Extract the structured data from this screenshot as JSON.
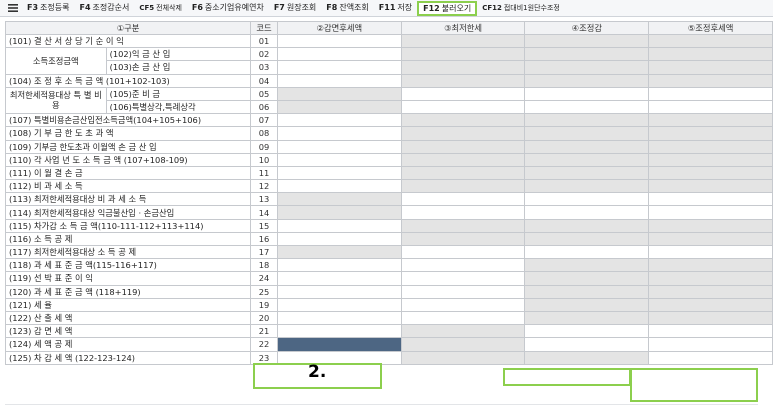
{
  "toolbar": {
    "menu_icon": "hamburger-menu-icon",
    "buttons": [
      {
        "key": "F3",
        "label": "조정등록"
      },
      {
        "key": "F4",
        "label": "조정감순서"
      },
      {
        "key": "CF5",
        "label": "전체삭제"
      },
      {
        "key": "F6",
        "label": "중소기업유예연차"
      },
      {
        "key": "F7",
        "label": "원장조회"
      },
      {
        "key": "F8",
        "label": "잔액조회"
      },
      {
        "key": "F11",
        "label": "저장"
      },
      {
        "key": "F12",
        "label": "불러오기"
      },
      {
        "key": "CF12",
        "label": "접대비1원단수조정"
      }
    ]
  },
  "table": {
    "headers": [
      "①구분",
      "코드",
      "②감면후세액",
      "③최저한세",
      "④조정감",
      "⑤조정후세액"
    ],
    "rows": [
      {
        "label": "(101) 결  산  서  상  당  기  순  이  익",
        "code": "01"
      },
      {
        "label": "소득조정금액",
        "sub": "(102)익  금  산  입",
        "code": "02"
      },
      {
        "sub": "(103)손  금  산  입",
        "code": "03"
      },
      {
        "label": "(104) 조  정  후  소  득  금  액 (101+102-103)",
        "code": "04"
      },
      {
        "label": "최저한세적용대상 특 별 비 용",
        "sub": "(105)준       비       금",
        "code": "05"
      },
      {
        "sub": "(106)특별상각,특례상각",
        "code": "06"
      },
      {
        "label": "(107) 특별비용손금산입전소득금액(104+105+106)",
        "code": "07"
      },
      {
        "label": "(108) 기   부   금     한   도   초   과   액",
        "code": "08"
      },
      {
        "label": "(109) 기부금 한도초과 이월액   손  금  산  입",
        "code": "09"
      },
      {
        "label": "(110) 각  사업 년 도 소 득 금 액 (107+108-109)",
        "code": "10"
      },
      {
        "label": "(111) 이        월        결        손        금",
        "code": "11"
      },
      {
        "label": "(112) 비        과        세        소        득",
        "code": "12"
      },
      {
        "label": "(113) 최저한세적용대상   비  과  세  소  득",
        "code": "13"
      },
      {
        "label": "(114) 최저한세적용대상   익금불산입 · 손금산입",
        "code": "14"
      },
      {
        "label": "(115) 차가감 소 득 금 액(110-111-112+113+114)",
        "code": "15"
      },
      {
        "label": "(116) 소        득        공        제",
        "code": "16"
      },
      {
        "label": "(117) 최저한세적용대상   소    득    공    제",
        "code": "17"
      },
      {
        "label": "(118) 과  세  표  준  금  액(115-116+117)",
        "code": "18"
      },
      {
        "label": "(119) 선     박     표     준     이     익",
        "code": "24"
      },
      {
        "label": "(120) 과   세   표  준  금  액 (118+119)",
        "code": "25"
      },
      {
        "label": "(121) 세                                   율",
        "code": "19"
      },
      {
        "label": "(122) 산        출        세        액",
        "code": "20"
      },
      {
        "label": "(123) 감        면        세        액",
        "code": "21"
      },
      {
        "label": "(124) 세        액        공        제",
        "code": "22"
      },
      {
        "label": "(125) 차    감    세    액  (122-123-124)",
        "code": "23"
      }
    ]
  },
  "annotation": "2.",
  "colors": {
    "highlight_outline": "#8ccf4d",
    "selected_cell": "#4d6683",
    "disabled_cell": "#e4e4e4",
    "header_bg": "#f1f2f4"
  }
}
